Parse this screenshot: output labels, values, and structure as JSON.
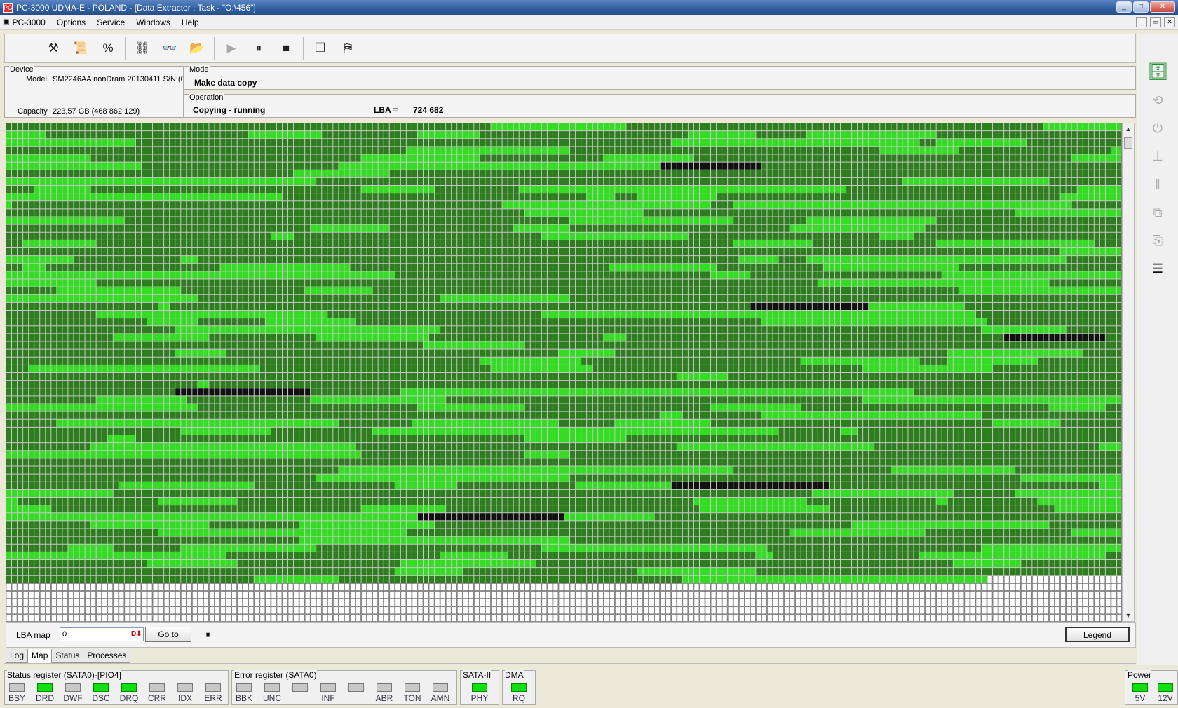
{
  "window": {
    "title": "PC-3000 UDMA-E - POLAND - [Data Extractor : Task - \"O:\\456\"]",
    "icon_text": "PC"
  },
  "menu": {
    "items": [
      "PC-3000",
      "Options",
      "Service",
      "Windows",
      "Help"
    ]
  },
  "toolbar": {
    "buttons": [
      {
        "name": "tools-icon",
        "glyph": "⚒"
      },
      {
        "name": "scroll-icon",
        "glyph": "📜"
      },
      {
        "name": "percent-doc-icon",
        "glyph": "%"
      },
      {
        "name": "tree-icon",
        "glyph": "⛓"
      },
      {
        "name": "binoculars-icon",
        "glyph": "👓"
      },
      {
        "name": "folder-open-icon",
        "glyph": "📂"
      },
      {
        "name": "play-icon",
        "glyph": "▶"
      },
      {
        "name": "pause-icon",
        "glyph": "⏸"
      },
      {
        "name": "stop-icon",
        "glyph": "■"
      },
      {
        "name": "copy-windows-icon",
        "glyph": "❐"
      },
      {
        "name": "exit-icon",
        "glyph": "⛿"
      }
    ]
  },
  "device": {
    "legend": "Device",
    "model_label": "Model",
    "model_value": "SM2246AA nonDram 20130411 S/N:(0",
    "capacity_label": "Capacity",
    "capacity_value": "223,57 GB (468 862 129)"
  },
  "mode": {
    "legend": "Mode",
    "value": "Make data copy"
  },
  "operation": {
    "legend": "Operation",
    "status": "Copying - running",
    "lba_label": "LBA =",
    "lba_value": "724 682"
  },
  "map_controls": {
    "lba_map_label": "LBA map",
    "lba_input_value": "0",
    "goto_label": "Go to",
    "pause_glyph": "⏸",
    "legend_label": "Legend"
  },
  "tabs": [
    {
      "label": "Log",
      "active": false
    },
    {
      "label": "Map",
      "active": true
    },
    {
      "label": "Status",
      "active": false
    },
    {
      "label": "Processes",
      "active": false
    }
  ],
  "status_register": {
    "title": "Status register (SATA0)-[PIO4]",
    "leds": [
      {
        "label": "BSY",
        "on": false
      },
      {
        "label": "DRD",
        "on": true
      },
      {
        "label": "DWF",
        "on": false
      },
      {
        "label": "DSC",
        "on": true
      },
      {
        "label": "DRQ",
        "on": true
      },
      {
        "label": "CRR",
        "on": false
      },
      {
        "label": "IDX",
        "on": false
      },
      {
        "label": "ERR",
        "on": false
      }
    ]
  },
  "error_register": {
    "title": "Error register (SATA0)",
    "leds": [
      {
        "label": "BBK",
        "on": false
      },
      {
        "label": "UNC",
        "on": false
      },
      {
        "label": "",
        "on": false
      },
      {
        "label": "INF",
        "on": false
      },
      {
        "label": "",
        "on": false
      },
      {
        "label": "ABR",
        "on": false
      },
      {
        "label": "TON",
        "on": false
      },
      {
        "label": "AMN",
        "on": false
      }
    ]
  },
  "sata": {
    "title": "SATA-II",
    "leds": [
      {
        "label": "PHY",
        "on": true
      }
    ]
  },
  "dma": {
    "title": "DMA",
    "leds": [
      {
        "label": "RQ",
        "on": true
      }
    ]
  },
  "power": {
    "title": "Power",
    "leds": [
      {
        "label": "5V",
        "on": true
      },
      {
        "label": "12V",
        "on": true
      }
    ]
  },
  "map_colors": {
    "dark_green": "#2e7d1e",
    "light_green": "#33dd22",
    "bad_black": "#111111",
    "unread_white": "#ffffff"
  },
  "map_state": {
    "read_fraction": 0.92,
    "rows": 64,
    "cols": 198
  },
  "right_panel": {
    "icons": [
      {
        "name": "database-icon",
        "glyph": "🗄"
      },
      {
        "name": "reset-icon",
        "glyph": "⟲"
      },
      {
        "name": "power-icon",
        "glyph": "⏻"
      },
      {
        "name": "tap-icon",
        "glyph": "⊥"
      },
      {
        "name": "pause-small-icon",
        "glyph": "‖"
      },
      {
        "name": "network-icon",
        "glyph": "⧉"
      },
      {
        "name": "copy-cancel-icon",
        "glyph": "⎘"
      },
      {
        "name": "settings-bars-icon",
        "glyph": "☰"
      }
    ]
  }
}
